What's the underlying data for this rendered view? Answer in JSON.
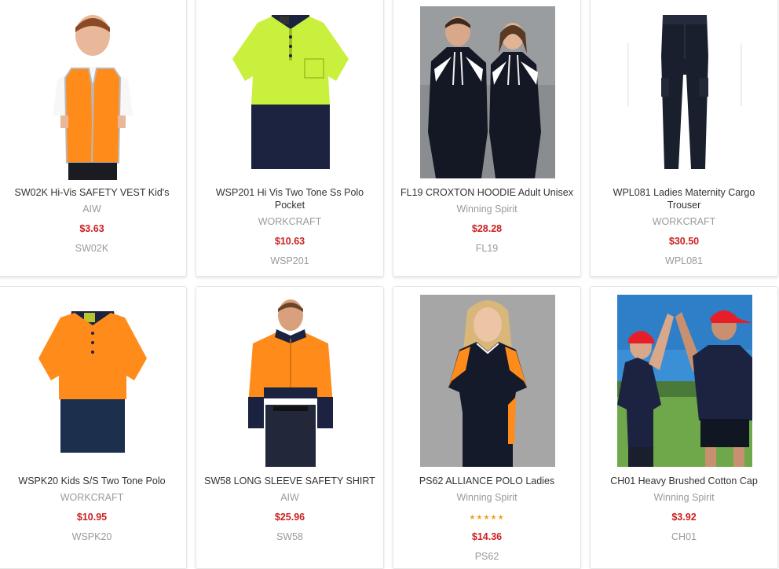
{
  "products": [
    {
      "title": "SW02K Hi-Vis SAFETY VEST Kid's",
      "brand": "AIW",
      "price": "$3.63",
      "sku": "SW02K",
      "image": "kid-hivis-vest-photo"
    },
    {
      "title": "WSP201 Hi Vis Two Tone Ss Polo Pocket",
      "brand": "WORKCRAFT",
      "price": "$10.63",
      "sku": "WSP201",
      "image": "hivis-two-tone-polo-photo"
    },
    {
      "title": "FL19 CROXTON HOODIE Adult Unisex",
      "brand": "Winning Spirit",
      "price": "$28.28",
      "sku": "FL19",
      "image": "couple-hoodie-photo"
    },
    {
      "title": "WPL081 Ladies Maternity Cargo Trouser",
      "brand": "WORKCRAFT",
      "price": "$30.50",
      "sku": "WPL081",
      "image": "maternity-cargo-trouser-photo"
    },
    {
      "title": "WSPK20 Kids S/S Two Tone Polo",
      "brand": "WORKCRAFT",
      "price": "$10.95",
      "sku": "WSPK20",
      "image": "kids-two-tone-polo-photo"
    },
    {
      "title": "SW58 LONG SLEEVE SAFETY SHIRT",
      "brand": "AIW",
      "price": "$25.96",
      "sku": "SW58",
      "image": "man-safety-shirt-photo"
    },
    {
      "title": "PS62 ALLIANCE POLO Ladies",
      "brand": "Winning Spirit",
      "price": "$14.36",
      "sku": "PS62",
      "rating": "★★★★★",
      "image": "woman-polo-photo"
    },
    {
      "title": "CH01 Heavy Brushed Cotton Cap",
      "brand": "Winning Spirit",
      "price": "$3.92",
      "sku": "CH01",
      "image": "cap-people-photo"
    }
  ],
  "colors": {
    "price": "#cc1f1f",
    "muted": "#9a9a9a",
    "text": "#333333",
    "hivis_yellow": "#c8f03c",
    "hivis_orange": "#ff8c1a",
    "navy": "#1c2340"
  }
}
